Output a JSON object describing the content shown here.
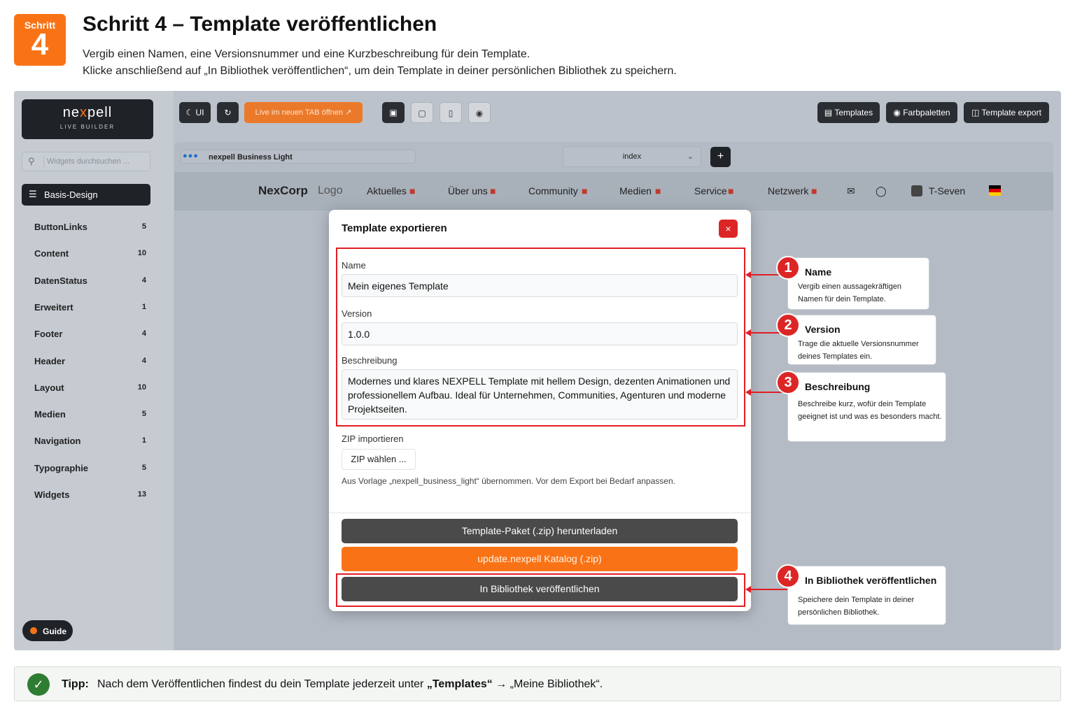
{
  "header": {
    "step_label": "Schritt",
    "step_number": "4",
    "title": "Schritt 4 – Template veröffentlichen",
    "subtitle_line1": "Vergib einen Namen, eine Versionsnummer und eine Kurzbeschreibung für dein Template.",
    "subtitle_line2": "Klicke anschließend auf „In Bibliothek veröffentlichen“, um dein Template in deiner persönlichen Bibliothek zu speichern."
  },
  "sidebar": {
    "logo_name_pre": "ne",
    "logo_name_x": "x",
    "logo_name_post": "pell",
    "logo_sub": "LIVE BUILDER",
    "search_placeholder": "Widgets durchsuchen ...",
    "basis_label": "Basis-Design",
    "categories": [
      {
        "label": "ButtonLinks",
        "count": "5"
      },
      {
        "label": "Content",
        "count": "10"
      },
      {
        "label": "DatenStatus",
        "count": "4"
      },
      {
        "label": "Erweitert",
        "count": "1"
      },
      {
        "label": "Footer",
        "count": "4"
      },
      {
        "label": "Header",
        "count": "4"
      },
      {
        "label": "Layout",
        "count": "10"
      },
      {
        "label": "Medien",
        "count": "5"
      },
      {
        "label": "Navigation",
        "count": "1"
      },
      {
        "label": "Typographie",
        "count": "5"
      },
      {
        "label": "Widgets",
        "count": "13"
      }
    ],
    "guide_label": "Guide"
  },
  "toolbar": {
    "ui_label": "UI",
    "live_label": "Live im neuen TAB öffnen",
    "templates_label": "Templates",
    "palettes_label": "Farbpaletten",
    "export_label": "Template export"
  },
  "preview": {
    "site_name": "nexpell Business Light",
    "page_select": "index",
    "plus": "+",
    "nav": {
      "brand": "NexCorp",
      "logo": "Logo",
      "items": [
        "Aktuelles",
        "Über uns",
        "Community",
        "Medien",
        "Service",
        "Netzwerk"
      ],
      "user": "T-Seven"
    }
  },
  "modal": {
    "title": "Template exportieren",
    "close": "×",
    "name_label": "Name",
    "name_value": "Mein eigenes Template",
    "version_label": "Version",
    "version_value": "1.0.0",
    "desc_label": "Beschreibung",
    "desc_value": "Modernes und klares NEXPELL Template mit hellem Design, dezenten Animationen und professionellem Aufbau. Ideal für Unternehmen, Communities, Agenturen und moderne Projektseiten.",
    "zip_label": "ZIP importieren",
    "zip_button": "ZIP wählen ...",
    "note": "Aus Vorlage „nexpell_business_light“ übernommen. Vor dem Export bei Bedarf anpassen.",
    "btn_download": "Template-Paket (.zip) herunterladen",
    "btn_catalog": "update.nexpell Katalog (.zip)",
    "btn_publish": "In Bibliothek veröffentlichen"
  },
  "callouts": [
    {
      "num": "1",
      "title": "Name",
      "desc": "Vergib einen aussagekräftigen Namen für dein Template."
    },
    {
      "num": "2",
      "title": "Version",
      "desc": "Trage die aktuelle Versionsnummer deines Templates ein."
    },
    {
      "num": "3",
      "title": "Beschreibung",
      "desc": "Beschreibe kurz, wofür dein Template geeignet ist und was es besonders macht."
    },
    {
      "num": "4",
      "title": "In Bibliothek veröffentlichen",
      "desc": "Speichere dein Template in deiner persönlichen Bibliothek."
    }
  ],
  "tip": {
    "label": "Tipp:",
    "text_pre": "Nach dem Veröffentlichen findest du dein Template jederzeit unter ",
    "text_bold": "„Templates“",
    "text_post": " → „Meine Bibliothek“."
  },
  "colors": {
    "accent": "#f97316",
    "highlight_red": "#e11d24",
    "dark": "#1f2328",
    "success": "#2e7d32"
  }
}
